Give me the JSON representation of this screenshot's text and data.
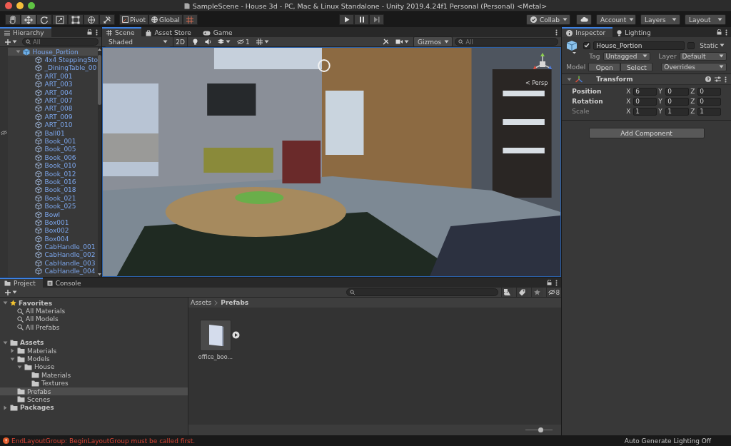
{
  "window": {
    "title": "SampleScene - House 3d - PC, Mac & Linux Standalone - Unity 2019.4.24f1 Personal (Personal) <Metal>"
  },
  "toolbar": {
    "tools": [
      {
        "kind": "hand",
        "selected": false
      },
      {
        "kind": "move",
        "selected": true
      },
      {
        "kind": "rotate",
        "selected": false
      },
      {
        "kind": "scale",
        "selected": false
      },
      {
        "kind": "rect",
        "selected": false
      },
      {
        "kind": "transform",
        "selected": false
      },
      {
        "kind": "custom",
        "selected": false
      }
    ],
    "pivot": "Pivot",
    "space": "Global",
    "collab": "Collab",
    "account": "Account",
    "layers": "Layers",
    "layout": "Layout"
  },
  "hierarchy": {
    "tab": "Hierarchy",
    "search": {
      "placeholder": "All"
    },
    "items": [
      {
        "label": "House_Portion",
        "selected": true,
        "expanded": true,
        "hidden": false,
        "children": [
          {
            "label": "4x4 SteppingSto",
            "selected": false,
            "hidden": false
          },
          {
            "label": "_DiningTable_00",
            "selected": false,
            "hidden": false
          },
          {
            "label": "ART_001",
            "selected": false,
            "hidden": false
          },
          {
            "label": "ART_003",
            "selected": false,
            "hidden": false
          },
          {
            "label": "ART_004",
            "selected": false,
            "hidden": false
          },
          {
            "label": "ART_007",
            "selected": false,
            "hidden": false
          },
          {
            "label": "ART_008",
            "selected": false,
            "hidden": false
          },
          {
            "label": "ART_009",
            "selected": false,
            "hidden": false
          },
          {
            "label": "ART_010",
            "selected": false,
            "hidden": false
          },
          {
            "label": "Ball01",
            "selected": false,
            "hidden": true
          },
          {
            "label": "Book_001",
            "selected": false,
            "hidden": false
          },
          {
            "label": "Book_005",
            "selected": false,
            "hidden": false
          },
          {
            "label": "Book_006",
            "selected": false,
            "hidden": false
          },
          {
            "label": "Book_010",
            "selected": false,
            "hidden": false
          },
          {
            "label": "Book_012",
            "selected": false,
            "hidden": false
          },
          {
            "label": "Book_016",
            "selected": false,
            "hidden": false
          },
          {
            "label": "Book_018",
            "selected": false,
            "hidden": false
          },
          {
            "label": "Book_021",
            "selected": false,
            "hidden": false
          },
          {
            "label": "Book_025",
            "selected": false,
            "hidden": false
          },
          {
            "label": "Bowl",
            "selected": false,
            "hidden": false
          },
          {
            "label": "Box001",
            "selected": false,
            "hidden": false
          },
          {
            "label": "Box002",
            "selected": false,
            "hidden": false
          },
          {
            "label": "Box004",
            "selected": false,
            "hidden": false
          },
          {
            "label": "CabHandle_001",
            "selected": false,
            "hidden": false
          },
          {
            "label": "CabHandle_002",
            "selected": false,
            "hidden": false
          },
          {
            "label": "CabHandle_003",
            "selected": false,
            "hidden": false
          },
          {
            "label": "CabHandle_004",
            "selected": false,
            "hidden": false
          }
        ]
      }
    ]
  },
  "scene": {
    "tabs": [
      {
        "label": "Scene",
        "kind": "grid",
        "selected": true
      },
      {
        "label": "Asset Store",
        "kind": "bag",
        "selected": false
      },
      {
        "label": "Game",
        "kind": "gamepad",
        "selected": false
      }
    ],
    "shading": "Shaded",
    "mode_2d": "2D",
    "hidden_count": "1",
    "gizmos": "Gizmos",
    "search": {
      "placeholder": "All"
    },
    "view_label": "< Persp"
  },
  "inspector": {
    "tabs": [
      {
        "label": "Inspector",
        "kind": "info",
        "selected": true
      },
      {
        "label": "Lighting",
        "kind": "bulb",
        "selected": false
      }
    ],
    "object": {
      "active": true,
      "name": "House_Portion",
      "static_label": "Static",
      "static": false,
      "tag_label": "Tag",
      "tag": "Untagged",
      "layer_label": "Layer",
      "layer": "Default",
      "model_label": "Model",
      "open": "Open",
      "select": "Select",
      "overrides": "Overrides"
    },
    "components": [
      {
        "title": "Transform",
        "expanded": true,
        "rows": [
          {
            "label": "Position",
            "overridden": true,
            "values": [
              {
                "axis": "X",
                "value": "6"
              },
              {
                "axis": "Y",
                "value": "0"
              },
              {
                "axis": "Z",
                "value": "0"
              }
            ]
          },
          {
            "label": "Rotation",
            "overridden": true,
            "values": [
              {
                "axis": "X",
                "value": "0"
              },
              {
                "axis": "Y",
                "value": "0"
              },
              {
                "axis": "Z",
                "value": "0"
              }
            ]
          },
          {
            "label": "Scale",
            "overridden": false,
            "values": [
              {
                "axis": "X",
                "value": "1"
              },
              {
                "axis": "Y",
                "value": "1"
              },
              {
                "axis": "Z",
                "value": "1"
              }
            ]
          }
        ]
      }
    ],
    "add_component": "Add Component"
  },
  "project": {
    "tabs": [
      {
        "label": "Project",
        "kind": "folder",
        "selected": true
      },
      {
        "label": "Console",
        "kind": "console",
        "selected": false
      }
    ],
    "hidden_count": "8",
    "favorites": [
      {
        "label": "Favorites",
        "kind": "star",
        "expanded": true,
        "selected": false,
        "children": [
          {
            "label": "All Materials",
            "kind": "search",
            "selected": false
          },
          {
            "label": "All Models",
            "kind": "search",
            "selected": false
          },
          {
            "label": "All Prefabs",
            "kind": "search",
            "selected": false
          }
        ]
      }
    ],
    "tree": [
      {
        "label": "Assets",
        "kind": "folder",
        "expanded": true,
        "selected": false,
        "children": [
          {
            "label": "Materials",
            "kind": "folder",
            "expanded": false,
            "selected": false
          },
          {
            "label": "Models",
            "kind": "folder",
            "expanded": true,
            "selected": false,
            "children": [
              {
                "label": "House",
                "kind": "folder",
                "expanded": true,
                "selected": false,
                "children": [
                  {
                    "label": "Materials",
                    "kind": "folder",
                    "selected": false
                  },
                  {
                    "label": "Textures",
                    "kind": "folder",
                    "selected": false
                  }
                ]
              }
            ]
          },
          {
            "label": "Prefabs",
            "kind": "folder",
            "selected": true
          },
          {
            "label": "Scenes",
            "kind": "folder",
            "selected": false
          }
        ]
      },
      {
        "label": "Packages",
        "kind": "folder",
        "expanded": false,
        "selected": false
      }
    ],
    "breadcrumb": [
      "Assets",
      "Prefabs"
    ],
    "assets": [
      {
        "label": "office_boo...",
        "kind": "prefab"
      }
    ],
    "zoom": {
      "level": 0.55
    }
  },
  "status_bar": {
    "error": "EndLayoutGroup: BeginLayoutGroup must be called first.",
    "lighting": "Auto Generate Lighting Off"
  }
}
